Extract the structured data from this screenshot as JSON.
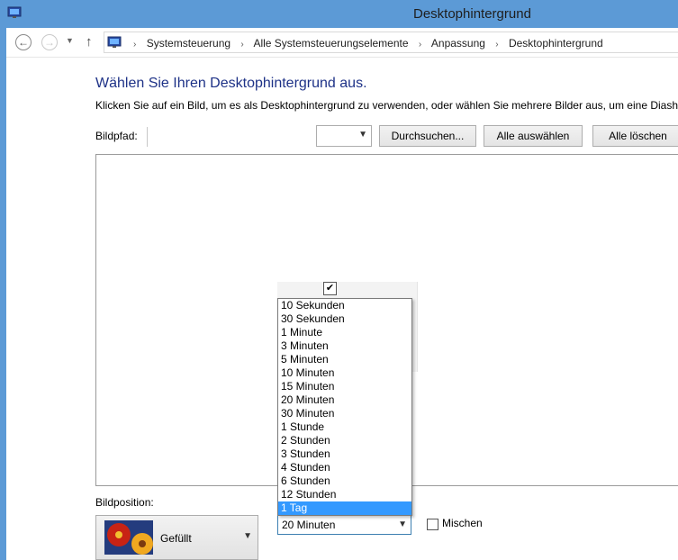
{
  "window": {
    "title": "Desktophintergrund",
    "icon": "monitor-icon"
  },
  "nav": {
    "back_icon": "←",
    "forward_icon": "→",
    "recent_icon": "▼",
    "up_icon": "↑",
    "separator": "›",
    "breadcrumbs": [
      "Systemsteuerung",
      "Alle Systemsteuerungselemente",
      "Anpassung",
      "Desktophintergrund"
    ]
  },
  "main": {
    "heading": "Wählen Sie Ihren Desktophintergrund aus.",
    "subtext": "Klicken Sie auf ein Bild, um es als Desktophintergrund zu verwenden, oder wählen Sie mehrere Bilder aus, um eine Diashow",
    "path_label": "Bildpfad:",
    "path_select_value": "",
    "buttons": {
      "browse": "Durchsuchen...",
      "select_all": "Alle auswählen",
      "clear_all": "Alle löschen"
    },
    "check_mark": "✔"
  },
  "position": {
    "label": "Bildposition:",
    "value": "Gefüllt"
  },
  "slideshow": {
    "interval_value": "20 Minuten",
    "options": [
      "10 Sekunden",
      "30 Sekunden",
      "1 Minute",
      "3 Minuten",
      "5 Minuten",
      "10 Minuten",
      "15 Minuten",
      "20 Minuten",
      "30 Minuten",
      "1 Stunde",
      "2 Stunden",
      "3 Stunden",
      "4 Stunden",
      "6 Stunden",
      "12 Stunden",
      "1 Tag"
    ],
    "highlighted": "1 Tag",
    "shuffle_label": "Mischen"
  },
  "colors": {
    "title_bar": "#5c9ad6",
    "heading": "#1e3287",
    "highlight": "#3399ff"
  }
}
